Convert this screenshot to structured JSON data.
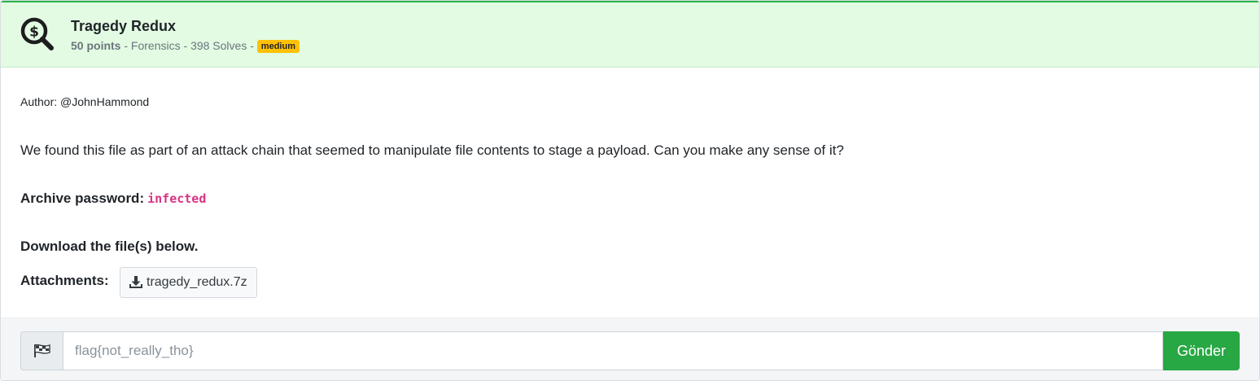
{
  "challenge": {
    "title": "Tragedy Redux",
    "points": "50 points",
    "category": "Forensics",
    "solves": "398 Solves",
    "difficulty": "medium",
    "separator": " - "
  },
  "body": {
    "author": "Author: @JohnHammond",
    "description": "We found this file as part of an attack chain that seemed to manipulate file contents to stage a payload. Can you make any sense of it?",
    "password_label": "Archive password:",
    "password_value": "infected",
    "download_note": "Download the file(s) below.",
    "attachments_label": "Attachments:",
    "attachment_name": "tragedy_redux.7z"
  },
  "flag_form": {
    "placeholder": "flag{not_really_tho}",
    "submit_label": "Gönder"
  },
  "icons": {
    "header": "money-search-icon",
    "download": "download-icon",
    "flag": "checkered-flag-icon"
  },
  "colors": {
    "header_bg": "#e2fbe2",
    "badge": "#ffc107",
    "submit": "#28a745",
    "code": "#d63384"
  }
}
